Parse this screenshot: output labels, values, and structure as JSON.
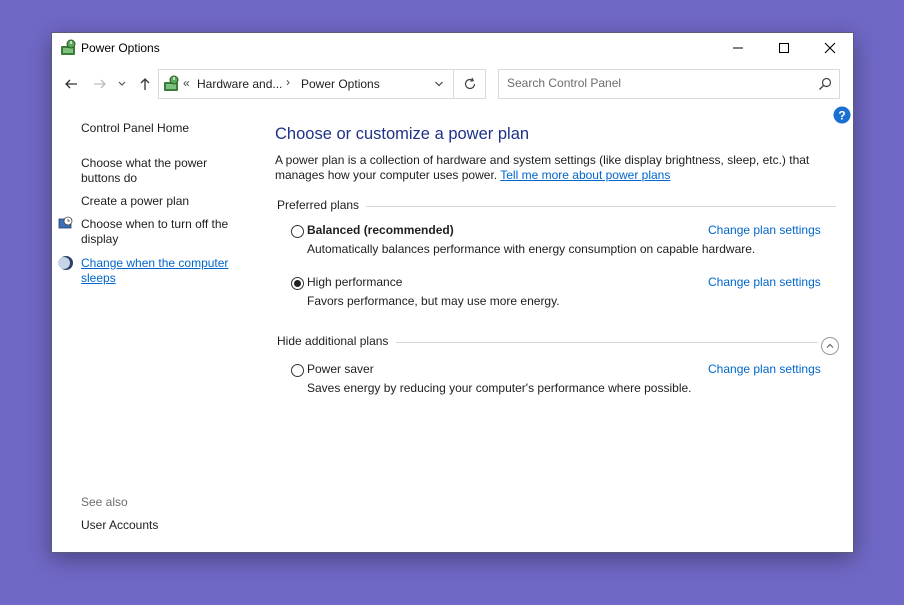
{
  "window": {
    "title": "Power Options",
    "icon": "power-options-icon"
  },
  "nav": {
    "address": {
      "chevrons": "«",
      "segment1": "Hardware and...",
      "separator": "›",
      "segment2": "Power Options"
    },
    "search": {
      "placeholder": "Search Control Panel"
    }
  },
  "sidebar": {
    "items": [
      {
        "label": "Control Panel Home"
      },
      {
        "label": "Choose what the power buttons do"
      },
      {
        "label": "Create a power plan"
      },
      {
        "label": "Choose when to turn off the display"
      },
      {
        "label": "Change when the computer sleeps"
      }
    ],
    "see_also": "See also",
    "see_also_items": [
      {
        "label": "User Accounts"
      }
    ]
  },
  "main": {
    "title": "Choose or customize a power plan",
    "description": "A power plan is a collection of hardware and system settings (like display brightness, sleep, etc.) that manages how your computer uses power.",
    "tell_more": "Tell me more about power plans",
    "preferred_header": "Preferred plans",
    "additional_header": "Hide additional plans",
    "plans": [
      {
        "name": "Balanced (recommended)",
        "desc": "Automatically balances performance with energy consumption on capable hardware.",
        "change": "Change plan settings",
        "selected": false
      },
      {
        "name": "High performance",
        "desc": "Favors performance, but may use more energy.",
        "change": "Change plan settings",
        "selected": true
      },
      {
        "name": "Power saver",
        "desc": "Saves energy by reducing your computer's performance where possible.",
        "change": "Change plan settings",
        "selected": false
      }
    ]
  },
  "colors": {
    "background": "#7068c6",
    "link": "#0066cc",
    "title": "#1e3287"
  }
}
